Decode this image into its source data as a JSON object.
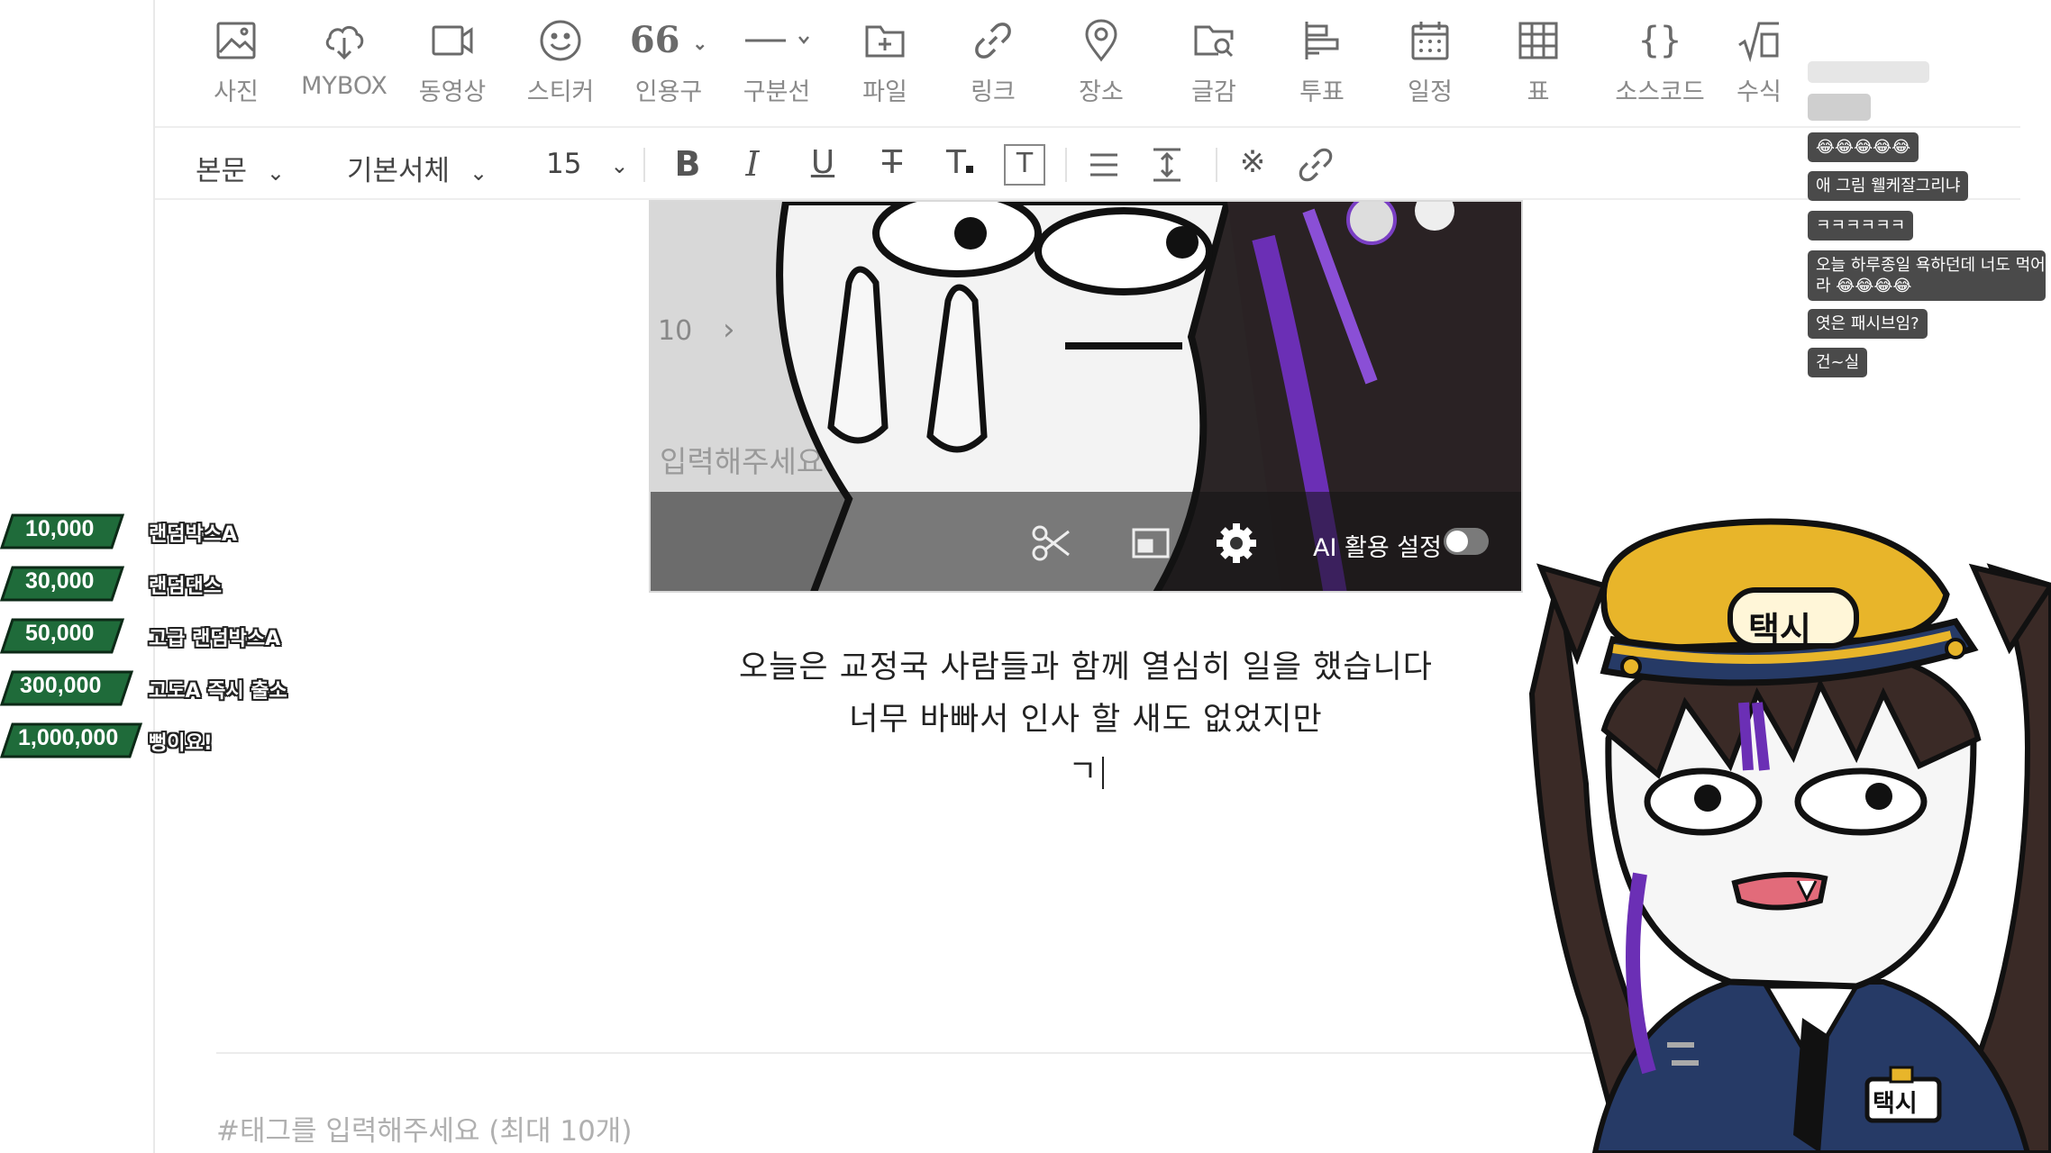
{
  "toolbar": {
    "items": [
      {
        "label": "사진",
        "icon": "photo-icon"
      },
      {
        "label": "MYBOX",
        "icon": "cloud-download-icon"
      },
      {
        "label": "동영상",
        "icon": "video-icon"
      },
      {
        "label": "스티커",
        "icon": "smile-icon"
      },
      {
        "label": "인용구",
        "icon": "quote-icon"
      },
      {
        "label": "구분선",
        "icon": "divider-icon"
      },
      {
        "label": "파일",
        "icon": "file-add-icon"
      },
      {
        "label": "링크",
        "icon": "link-icon"
      },
      {
        "label": "장소",
        "icon": "map-pin-icon"
      },
      {
        "label": "글감",
        "icon": "search-material-icon"
      },
      {
        "label": "투표",
        "icon": "poll-icon"
      },
      {
        "label": "일정",
        "icon": "calendar-icon"
      },
      {
        "label": "표",
        "icon": "table-icon"
      },
      {
        "label": "소스코드",
        "icon": "code-braces-icon"
      },
      {
        "label": "수식",
        "icon": "formula-icon"
      }
    ],
    "quote_glyph": "66"
  },
  "format": {
    "paragraph": "본문",
    "font": "기본서체",
    "size": "15"
  },
  "image": {
    "page_number": "10",
    "chevron": "›",
    "placeholder": "입력해주세요",
    "ai_label": "AI 활용 설정",
    "ai_enabled": false
  },
  "body": {
    "line1": "오늘은 교정국 사람들과 함께 열심히 일을 했습니다",
    "line2": "너무 바빠서 인사 할 새도 없었지만",
    "line3": "ㄱ"
  },
  "tags": {
    "placeholder": "#태그를 입력해주세요 (최대 10개)"
  },
  "donations": [
    {
      "amount": "10,000",
      "label": "랜덤박스A"
    },
    {
      "amount": "30,000",
      "label": "랜덤댄스"
    },
    {
      "amount": "50,000",
      "label": "고급 랜덤박스A"
    },
    {
      "amount": "300,000",
      "label": "고도A 즉시 출소"
    },
    {
      "amount": "1,000,000",
      "label": "뻥이요!"
    }
  ],
  "chat": [
    "😂😂😂😂😂",
    "애 그림 웰케잘그리냐",
    "ㅋㅋㅋㅋㅋㅋ",
    "오늘 하루종일 욕하던데 너도 먹어",
    "라 😂😂😂😂",
    "엿은 패시브임?",
    "건~실"
  ],
  "mascot": {
    "cap_text": "택시",
    "badge_text": "택시"
  },
  "colors": {
    "donation_green": "#1f6b3a",
    "chat_bg": "#4a4a4a",
    "cap_yellow": "#e8b52a",
    "uniform_navy": "#263a66",
    "purple_accent": "#6b2fb5"
  }
}
